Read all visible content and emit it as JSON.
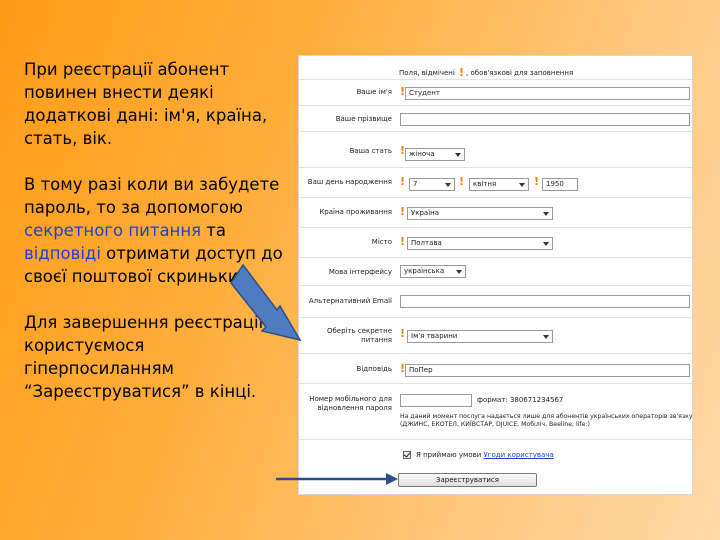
{
  "slide": {
    "para1": "При реєстрації абонент повинен внести деякі додаткові дані: ім'я, країна, стать, вік.",
    "para2_a": "В тому разі коли ви забудете пароль, то за допомогою ",
    "para2_hl1": "секретного питання",
    "para2_b": " та ",
    "para2_hl2": "відповіді",
    "para2_c": " отримати доступ до своєї поштової скриньки.",
    "para3": "Для завершення реєстрації користуємося гіперпосиланням “Зареєструватися” в кінці."
  },
  "form": {
    "legend_prefix": "Поля, відмічені",
    "legend_suffix": ", обов'язкові для заповнення",
    "required_mark": "!",
    "name_label": "Ваше ім'я",
    "name_value": "Студент",
    "surname_label": "Ваше прізвище",
    "surname_value": "",
    "gender_label": "Ваша стать",
    "gender_value": "жіноча",
    "birth_label": "Ваш день народження",
    "birth_day": "7",
    "birth_month": "квітня",
    "birth_year": "1950",
    "country_label": "Країна проживання",
    "country_value": "Україна",
    "city_label": "Місто",
    "city_value": "Полтава",
    "lang_label": "Мова інтерфейсу",
    "lang_value": "українська",
    "alt_email_label": "Альтернативний Email",
    "alt_email_value": "",
    "question_label": "Оберіть секретне питання",
    "question_value": "Ім'я тварини",
    "answer_label": "Відповідь",
    "answer_value": "ПоПер",
    "phone_label": "Номер мобільного для відновлення пароля",
    "phone_value": "",
    "phone_format": "формат: 380671234567",
    "phone_hint_1": "На даний момент послуга надається лише для абонентів українських операторів зв'язку",
    "phone_hint_2": "(ДЖИНС, ЕКОТЕЛ, КИЇВСТАР, DJUICE, Мобіліч, Beeline, life:)",
    "terms_text": "Я приймаю умови ",
    "terms_link": "Угоди користувача",
    "submit_label": "Зареєструватися"
  }
}
